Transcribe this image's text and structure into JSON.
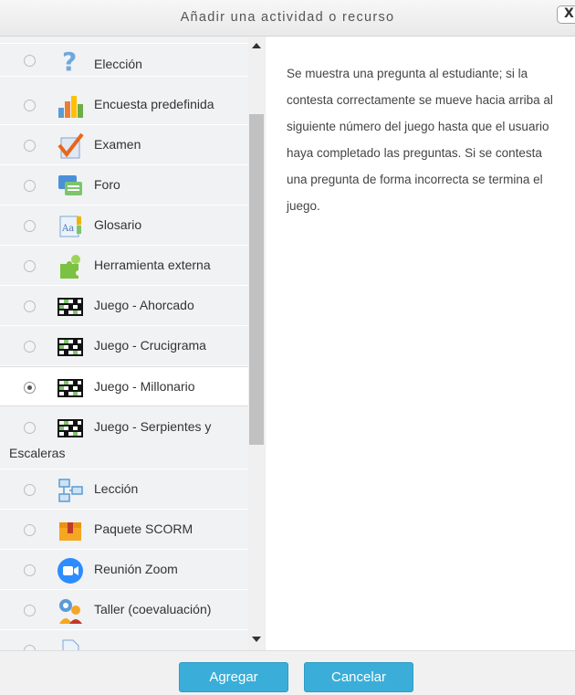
{
  "dialog": {
    "title": "Añadir una actividad o recurso",
    "close_label": "X"
  },
  "activities": [
    {
      "label": "Elección",
      "icon": "question-icon",
      "selected": false
    },
    {
      "label": "Encuesta predefinida",
      "icon": "bar-chart-icon",
      "selected": false
    },
    {
      "label": "Examen",
      "icon": "checkmark-paper-icon",
      "selected": false
    },
    {
      "label": "Foro",
      "icon": "forum-icon",
      "selected": false
    },
    {
      "label": "Glosario",
      "icon": "glossary-icon",
      "selected": false
    },
    {
      "label": "Herramienta externa",
      "icon": "puzzle-icon",
      "selected": false
    },
    {
      "label": "Juego - Ahorcado",
      "icon": "game-board-icon",
      "selected": false
    },
    {
      "label": "Juego - Crucigrama",
      "icon": "game-board-icon",
      "selected": false
    },
    {
      "label": "Juego - Millonario",
      "icon": "game-board-icon",
      "selected": true
    },
    {
      "label": "Juego - Serpientes y",
      "label_line2": "Escaleras",
      "icon": "game-board-icon",
      "selected": false
    },
    {
      "label": "Lección",
      "icon": "lesson-icon",
      "selected": false
    },
    {
      "label": "Paquete SCORM",
      "icon": "package-icon",
      "selected": false
    },
    {
      "label": "Reunión Zoom",
      "icon": "zoom-camera-icon",
      "selected": false
    },
    {
      "label": "Taller (coevaluación)",
      "icon": "workshop-icon",
      "selected": false
    }
  ],
  "description": "Se muestra una pregunta al estudiante; si la contesta correctamente se mueve hacia arriba al siguiente número del juego hasta que el usuario haya completado las preguntas. Si se contesta una pregunta de forma incorrecta se termina el juego.",
  "footer": {
    "add_label": "Agregar",
    "cancel_label": "Cancelar"
  },
  "colors": {
    "accent": "#3aaed8",
    "zoom_blue": "#2d8cff"
  }
}
